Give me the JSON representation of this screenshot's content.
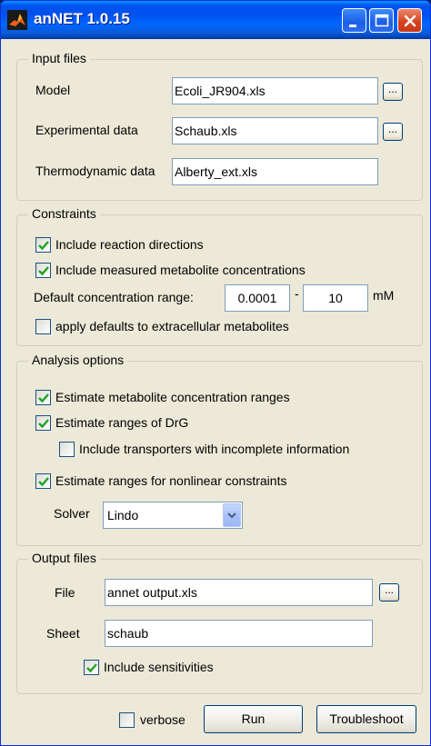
{
  "window": {
    "title": "anNET 1.0.15"
  },
  "input_files": {
    "group_title": "Input files",
    "model_label": "Model",
    "model_value": "Ecoli_JR904.xls",
    "experimental_label": "Experimental data",
    "experimental_value": "Schaub.xls",
    "thermo_label": "Thermodynamic data",
    "thermo_value": "Alberty_ext.xls",
    "browse_label": "..."
  },
  "constraints": {
    "group_title": "Constraints",
    "include_directions_label": "Include reaction directions",
    "include_directions_checked": true,
    "include_measured_label": "Include measured metabolite concentrations",
    "include_measured_checked": true,
    "default_range_label": "Default concentration range:",
    "range_min": "0.0001",
    "range_sep": "-",
    "range_max": "10",
    "range_unit": "mM",
    "apply_defaults_label": "apply defaults to extracellular metabolites",
    "apply_defaults_checked": false
  },
  "analysis": {
    "group_title": "Analysis options",
    "estimate_conc_label": "Estimate metabolite concentration ranges",
    "estimate_conc_checked": true,
    "estimate_drg_label": "Estimate ranges of DrG",
    "estimate_drg_checked": true,
    "include_transporters_label": "Include transporters with incomplete information",
    "include_transporters_checked": false,
    "estimate_nonlinear_label": "Estimate ranges for nonlinear constraints",
    "estimate_nonlinear_checked": true,
    "solver_label": "Solver",
    "solver_value": "Lindo"
  },
  "output": {
    "group_title": "Output files",
    "file_label": "File",
    "file_value": "annet output.xls",
    "sheet_label": "Sheet",
    "sheet_value": "schaub",
    "include_sens_label": "Include sensitivities",
    "include_sens_checked": true
  },
  "footer": {
    "verbose_label": "verbose",
    "verbose_checked": false,
    "run_label": "Run",
    "troubleshoot_label": "Troubleshoot"
  },
  "colors": {
    "titlebar": "#0054e3",
    "window_bg": "#ece9d8",
    "check_mark": "#21a121",
    "close_button": "#d64420"
  }
}
